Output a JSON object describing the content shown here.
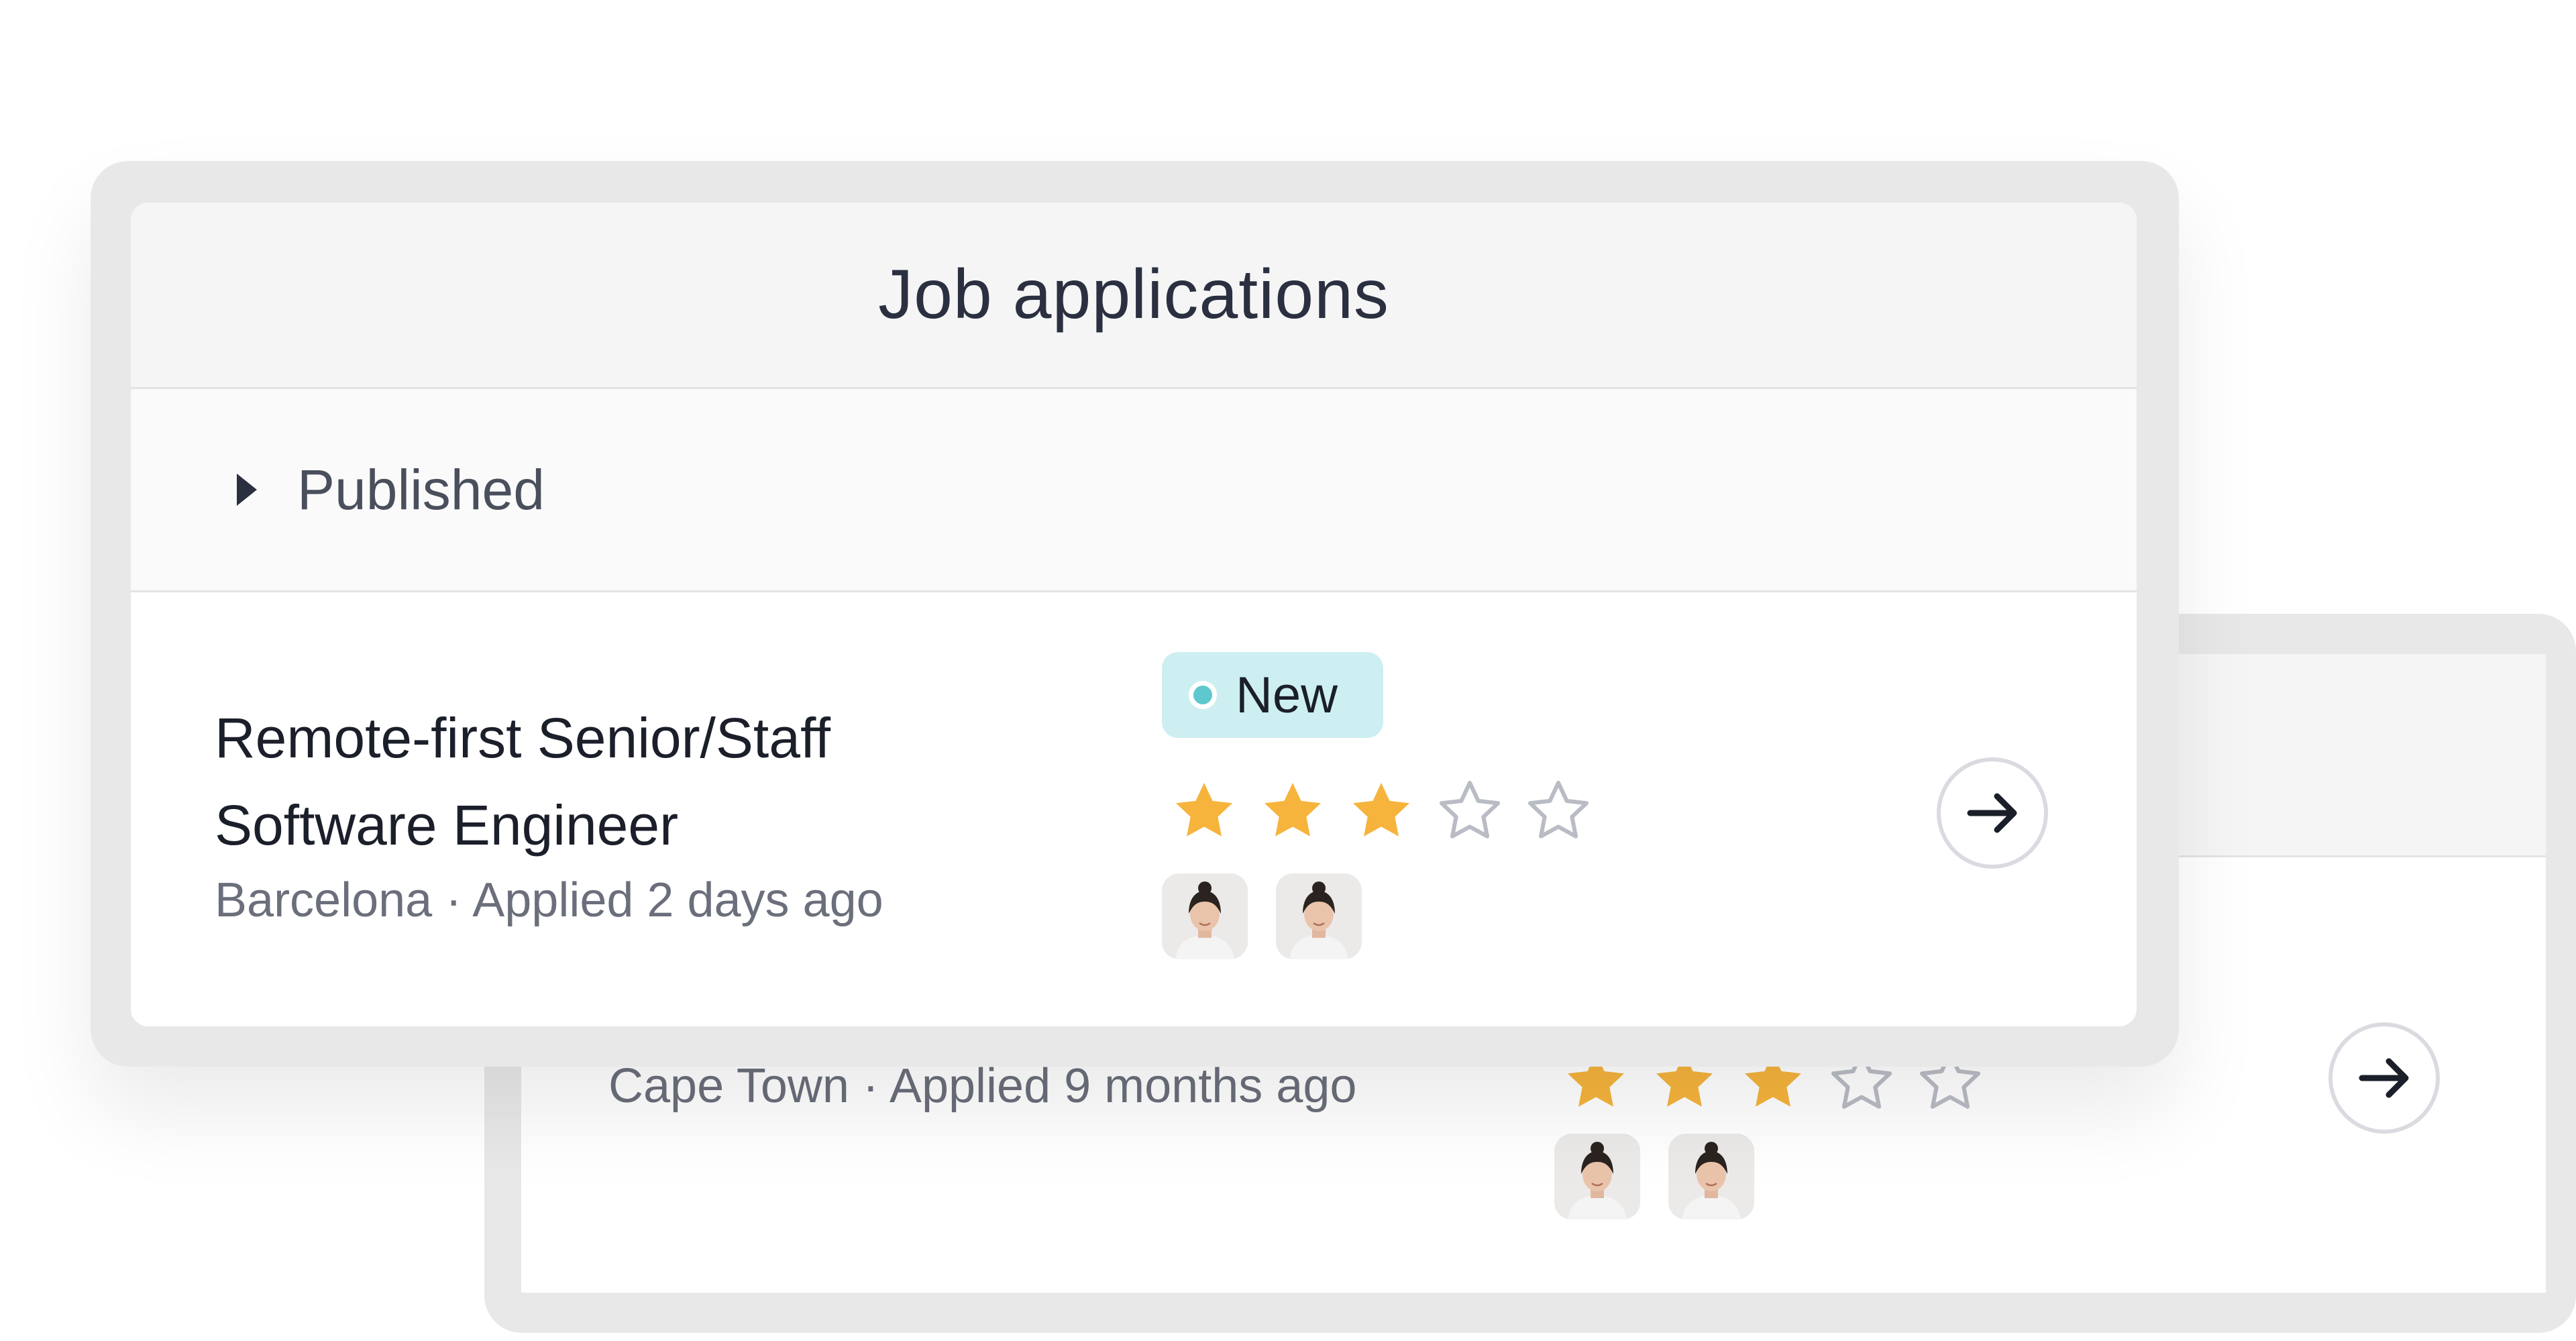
{
  "colors": {
    "star_filled": "#F6B43C",
    "star_empty": "#B9BCC4",
    "badge_bg": "#CDEFF2",
    "badge_dot": "#5FC8CF"
  },
  "front_card": {
    "title": "Job applications",
    "section": {
      "label": "Published",
      "expanded": false
    },
    "application": {
      "title_line1": "Remote-first Senior/Staff",
      "title_line2": "Software Engineer",
      "subtitle": "Barcelona · Applied 2 days ago",
      "status_badge": "New",
      "rating": 3,
      "rating_max": 5,
      "reviewers": [
        "reviewer-avatar",
        "reviewer-avatar"
      ],
      "open_icon": "arrow-right-icon"
    }
  },
  "back_card": {
    "application": {
      "subtitle": "Cape Town · Applied 9 months ago",
      "rating": 3,
      "rating_max": 5,
      "reviewers": [
        "reviewer-avatar",
        "reviewer-avatar"
      ],
      "open_icon": "arrow-right-icon"
    }
  }
}
